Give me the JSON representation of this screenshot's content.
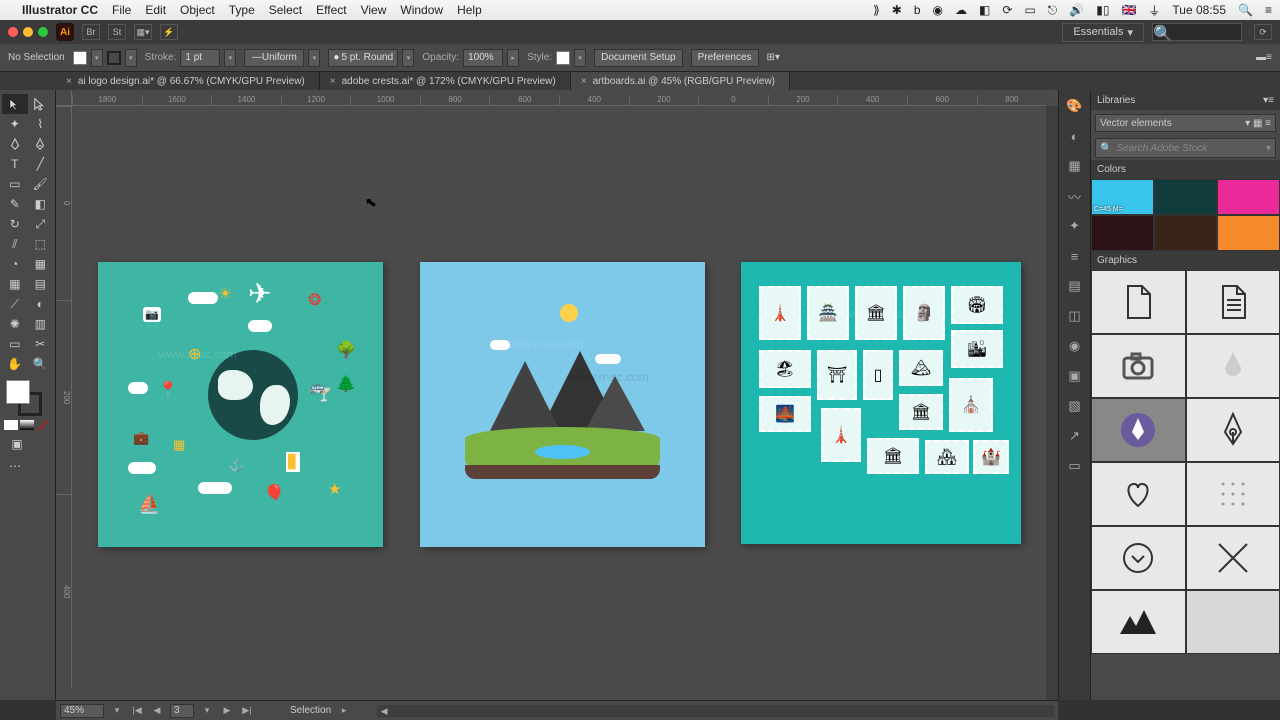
{
  "menubar": {
    "app": "Illustrator CC",
    "items": [
      "File",
      "Edit",
      "Object",
      "Type",
      "Select",
      "Effect",
      "View",
      "Window",
      "Help"
    ],
    "clock": "Tue 08:55"
  },
  "titlebar": {
    "workspace": "Essentials"
  },
  "control": {
    "selection_state": "No Selection",
    "stroke_label": "Stroke:",
    "stroke_weight": "1 pt",
    "stroke_profile": "Uniform",
    "brush": "5 pt. Round",
    "opacity_label": "Opacity:",
    "opacity": "100%",
    "style_label": "Style:",
    "doc_setup": "Document Setup",
    "prefs": "Preferences"
  },
  "tabs": [
    {
      "label": "ai logo design.ai* @ 66.67% (CMYK/GPU Preview)",
      "active": false
    },
    {
      "label": "adobe crests.ai* @ 172% (CMYK/GPU Preview)",
      "active": false
    },
    {
      "label": "artboards.ai @ 45% (RGB/GPU Preview)",
      "active": true
    }
  ],
  "ruler_h": [
    "1800",
    "1600",
    "1400",
    "1200",
    "1000",
    "800",
    "600",
    "400",
    "200",
    "0",
    "200",
    "400",
    "600",
    "800"
  ],
  "ruler_v": [
    "0",
    "200",
    "400"
  ],
  "status": {
    "zoom": "45%",
    "artboard_nav": "3",
    "tool": "Selection"
  },
  "libraries": {
    "title": "Libraries",
    "dropdown": "Vector elements",
    "search_placeholder": "Search Adobe Stock",
    "colors_label": "Colors",
    "colors": [
      {
        "hex": "#39c4ec",
        "label": "C=45 M="
      },
      {
        "hex": "#123b3b",
        "label": ""
      },
      {
        "hex": "#ec2a9a",
        "label": ""
      },
      {
        "hex": "#2a1216",
        "label": ""
      },
      {
        "hex": "#3a2317",
        "label": ""
      },
      {
        "hex": "#f58a2b",
        "label": ""
      }
    ],
    "graphics_label": "Graphics",
    "graphics": [
      "document",
      "text-doc",
      "camera",
      "droplet",
      "pen-purple",
      "pen",
      "heart",
      "dots",
      "clock",
      "cross",
      "mountain",
      "blank"
    ]
  },
  "watermark": "www.rr-sc.com"
}
